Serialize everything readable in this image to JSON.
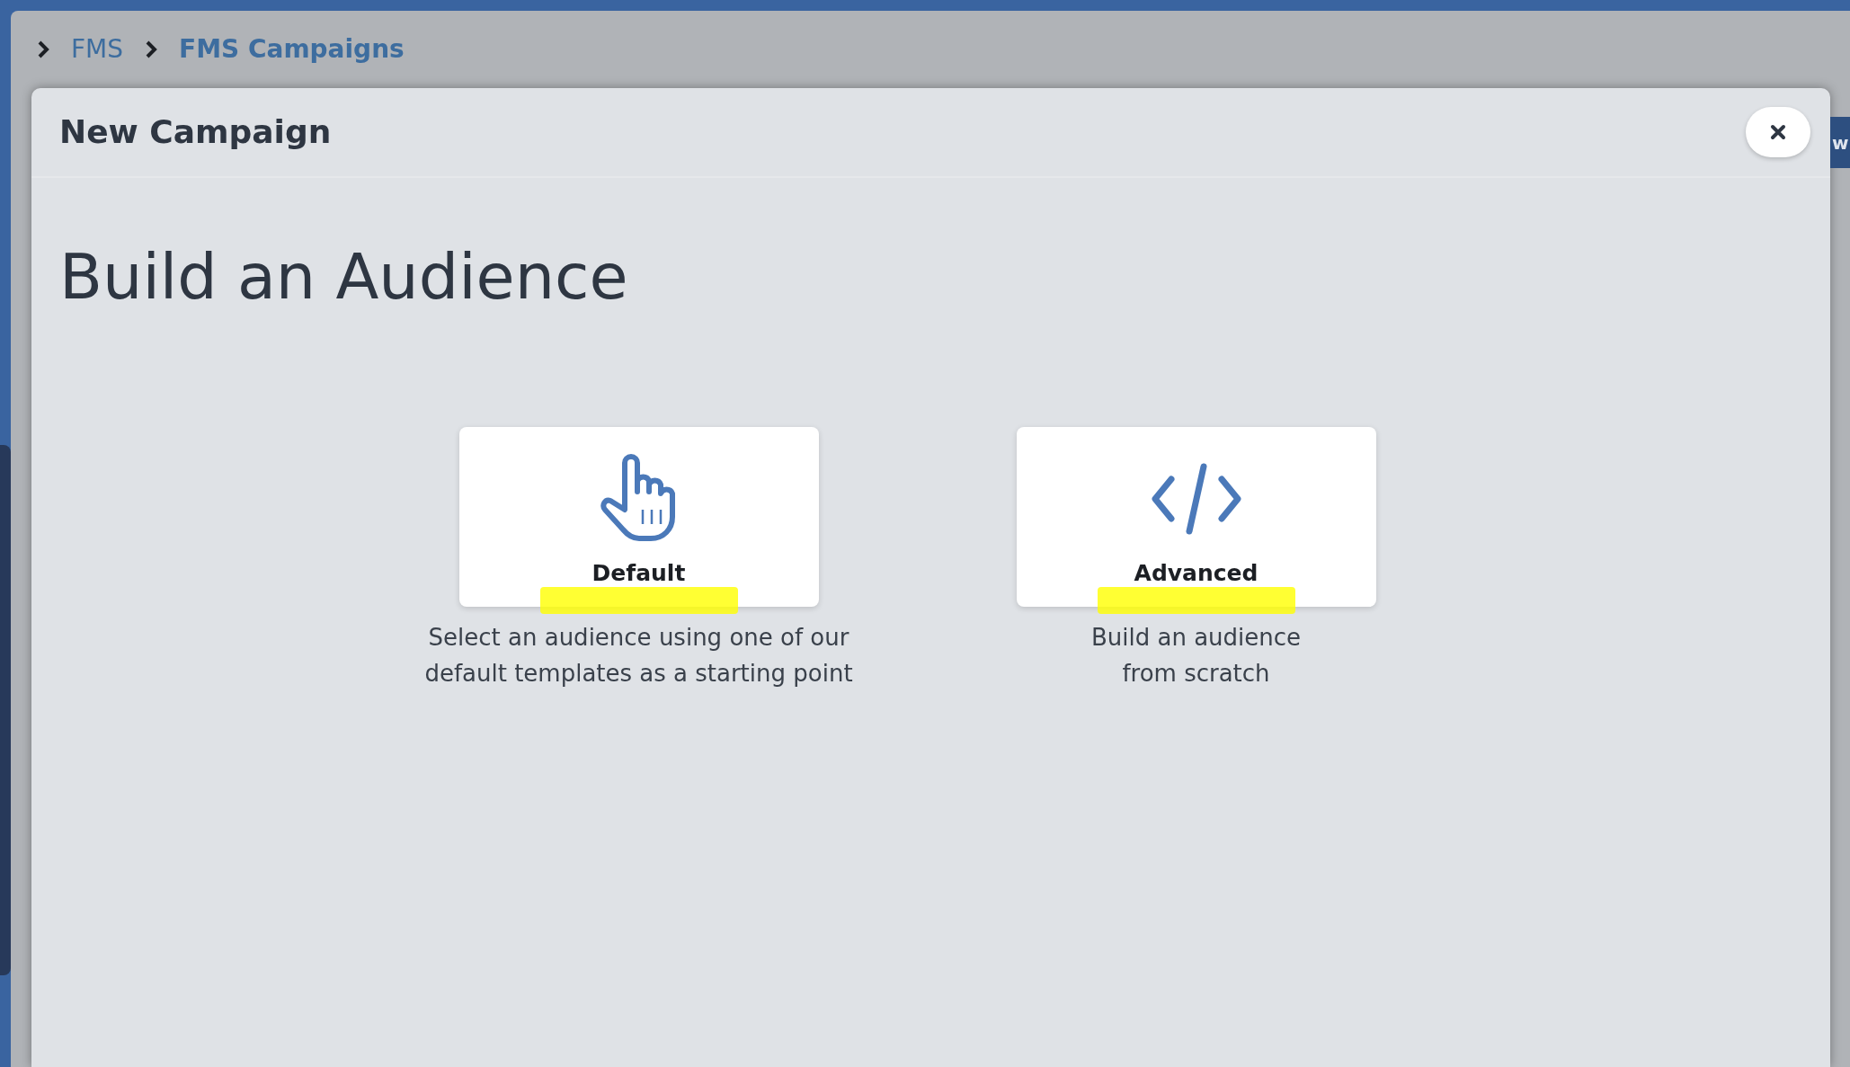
{
  "background": {
    "button_text": "w"
  },
  "breadcrumb": [
    {
      "label": "FMS",
      "current": false
    },
    {
      "label": "FMS Campaigns",
      "current": true
    }
  ],
  "modal": {
    "title": "New Campaign",
    "heading": "Build an Audience",
    "options": [
      {
        "kind": "pointer",
        "label": "Default",
        "description": "Select an audience using one of our default templates as a starting point",
        "highlighted": true
      },
      {
        "kind": "code",
        "label": "Advanced",
        "description": "Build an audience from scratch",
        "highlighted": true
      }
    ]
  }
}
